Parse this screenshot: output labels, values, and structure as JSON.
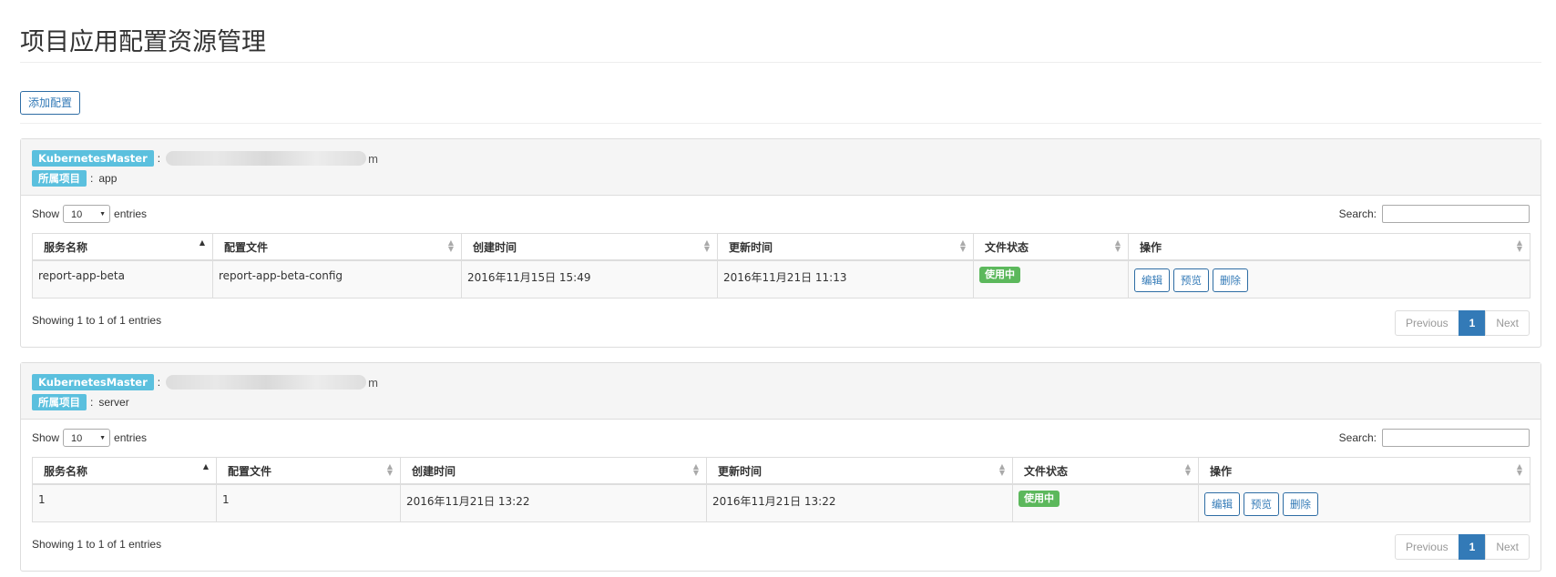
{
  "page": {
    "title": "项目应用配置资源管理",
    "add_button": "添加配置"
  },
  "common": {
    "master_label": "KubernetesMaster",
    "project_label": "所属项目",
    "colon": ":",
    "show": "Show",
    "entries": "entries",
    "page_size": "10",
    "search": "Search:",
    "prev": "Previous",
    "next": "Next",
    "page": "1",
    "status": "使用中",
    "edit": "编辑",
    "preview": "预览",
    "delete": "删除",
    "headers": [
      "服务名称",
      "配置文件",
      "创建时间",
      "更新时间",
      "文件状态",
      "操作"
    ]
  },
  "panels": [
    {
      "master_suffix": "m",
      "project": "app",
      "info": "Showing 1 to 1 of 1 entries",
      "row": {
        "service": "report-app-beta",
        "config": "report-app-beta-config",
        "created": "2016年11月15日 15:49",
        "updated": "2016年11月21日 11:13"
      }
    },
    {
      "master_suffix": "m",
      "project": "server",
      "info": "Showing 1 to 1 of 1 entries",
      "row": {
        "service": "1",
        "config": "1",
        "created": "2016年11月21日 13:22",
        "updated": "2016年11月21日 13:22"
      }
    }
  ]
}
